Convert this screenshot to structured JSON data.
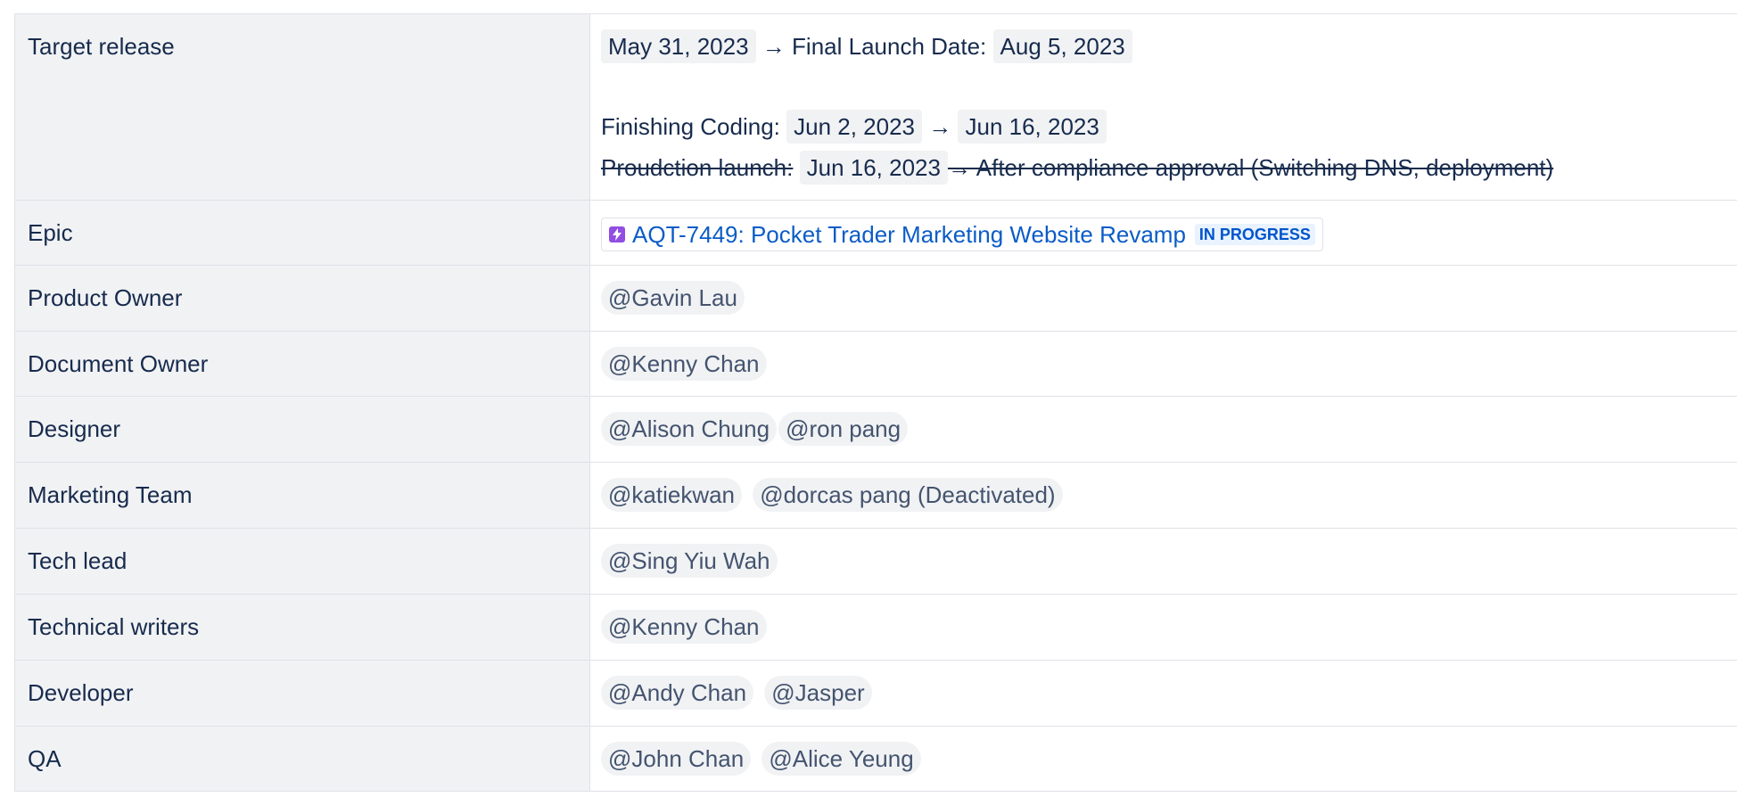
{
  "rows": [
    {
      "label": "Target release"
    },
    {
      "label": "Epic"
    },
    {
      "label": "Product Owner"
    },
    {
      "label": "Document Owner"
    },
    {
      "label": "Designer"
    },
    {
      "label": "Marketing Team"
    },
    {
      "label": "Tech lead"
    },
    {
      "label": "Technical writers"
    },
    {
      "label": "Developer"
    },
    {
      "label": "QA"
    }
  ],
  "target_release": {
    "line1": {
      "date_start": "May 31, 2023",
      "arrow": "→",
      "text": "Final Launch Date:",
      "date_end": "Aug 5, 2023"
    },
    "line2": {
      "text": "Finishing Coding:",
      "date_start": "Jun 2, 2023",
      "arrow": "→",
      "date_end": "Jun 16, 2023"
    },
    "line3": {
      "text": "Proudction launch:",
      "date": "Jun 16, 2023",
      "suffix": "→ After compliance approval  (Switching DNS, deployment)"
    }
  },
  "epic": {
    "link_text": "AQT-7449: Pocket Trader Marketing Website Revamp",
    "status": "IN PROGRESS"
  },
  "people": {
    "product_owner": [
      "@Gavin Lau"
    ],
    "document_owner": [
      "@Kenny Chan"
    ],
    "designer": [
      "@Alison Chung",
      "@ron pang"
    ],
    "marketing_team": [
      "@katiekwan",
      "@dorcas pang (Deactivated)"
    ],
    "tech_lead": [
      "@Sing Yiu Wah"
    ],
    "technical_writers": [
      "@Kenny Chan"
    ],
    "developer": [
      "@Andy Chan",
      "@Jasper"
    ],
    "qa": [
      "@John Chan",
      "@Alice Yeung"
    ]
  },
  "colors": {
    "header_bg": "#f1f2f4",
    "border": "#dfe1e6",
    "link": "#0b5cc7",
    "epic_icon": "#904ee2",
    "status_bg": "#e9f2ff"
  }
}
